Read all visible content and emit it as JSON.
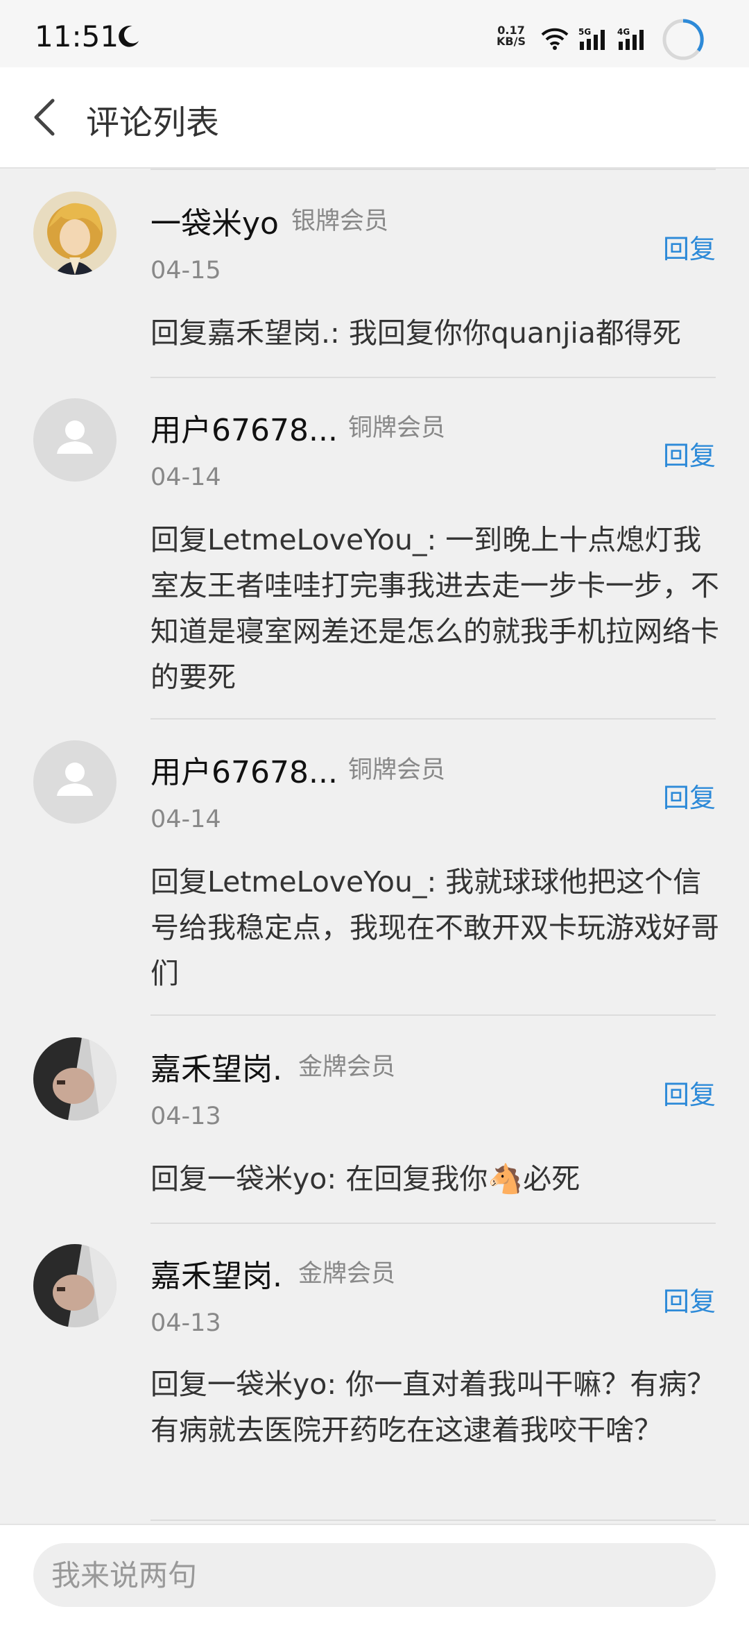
{
  "status_bar": {
    "time": "11:51",
    "speed_value": "0.17",
    "speed_unit": "KB/S",
    "net1": "5G",
    "net2": "4G",
    "icons": [
      "moon-icon",
      "wifi-icon",
      "signal-icon",
      "signal-icon",
      "loading-ring-icon"
    ]
  },
  "header": {
    "back_icon": "chevron-left-icon",
    "title": "评论列表"
  },
  "comments": [
    {
      "username": "一袋米yo",
      "badge": "银牌会员",
      "date": "04-15",
      "reply_label": "回复",
      "content": "回复嘉禾望岗.: 我回复你你quanjia都得死"
    },
    {
      "username": "用户67678...",
      "badge": "铜牌会员",
      "date": "04-14",
      "reply_label": "回复",
      "content": "回复LetmeLoveYou_: 一到晚上十点熄灯我室友王者哇哇打完事我进去走一步卡一步，不知道是寝室网差还是怎么的就我手机拉网络卡的要死"
    },
    {
      "username": "用户67678...",
      "badge": "铜牌会员",
      "date": "04-14",
      "reply_label": "回复",
      "content": "回复LetmeLoveYou_: 我就球球他把这个信号给我稳定点，我现在不敢开双卡玩游戏好哥们"
    },
    {
      "username": "嘉禾望岗.",
      "badge": "金牌会员",
      "date": "04-13",
      "reply_label": "回复",
      "content": "回复一袋米yo: 在回复我你🐴必死"
    },
    {
      "username": "嘉禾望岗.",
      "badge": "金牌会员",
      "date": "04-13",
      "reply_label": "回复",
      "content": "回复一袋米yo: 你一直对着我叫干嘛？有病？有病就去医院开药吃在这逮着我咬干啥？"
    }
  ],
  "input": {
    "placeholder": "我来说两句"
  },
  "colors": {
    "accent": "#2d8ad8",
    "background": "#f0f0f0"
  }
}
